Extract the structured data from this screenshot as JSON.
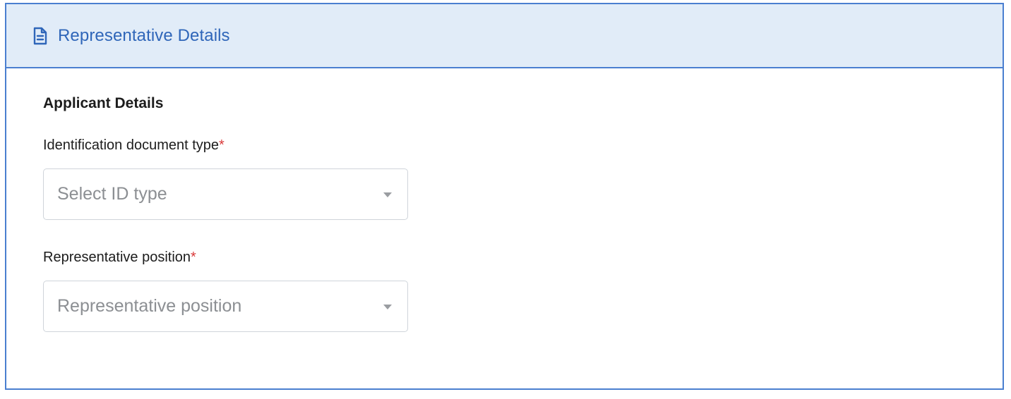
{
  "header": {
    "icon": "document-icon",
    "title": "Representative Details",
    "accent_color": "#2f66b9",
    "background_color": "#e1ecf8"
  },
  "section": {
    "title": "Applicant Details"
  },
  "fields": [
    {
      "label": "Identification document type",
      "required_marker": "*",
      "placeholder": "Select ID type",
      "control": "select"
    },
    {
      "label": "Representative position",
      "required_marker": "*",
      "placeholder": "Representative position",
      "control": "select"
    }
  ],
  "required_color": "#d93a3a"
}
